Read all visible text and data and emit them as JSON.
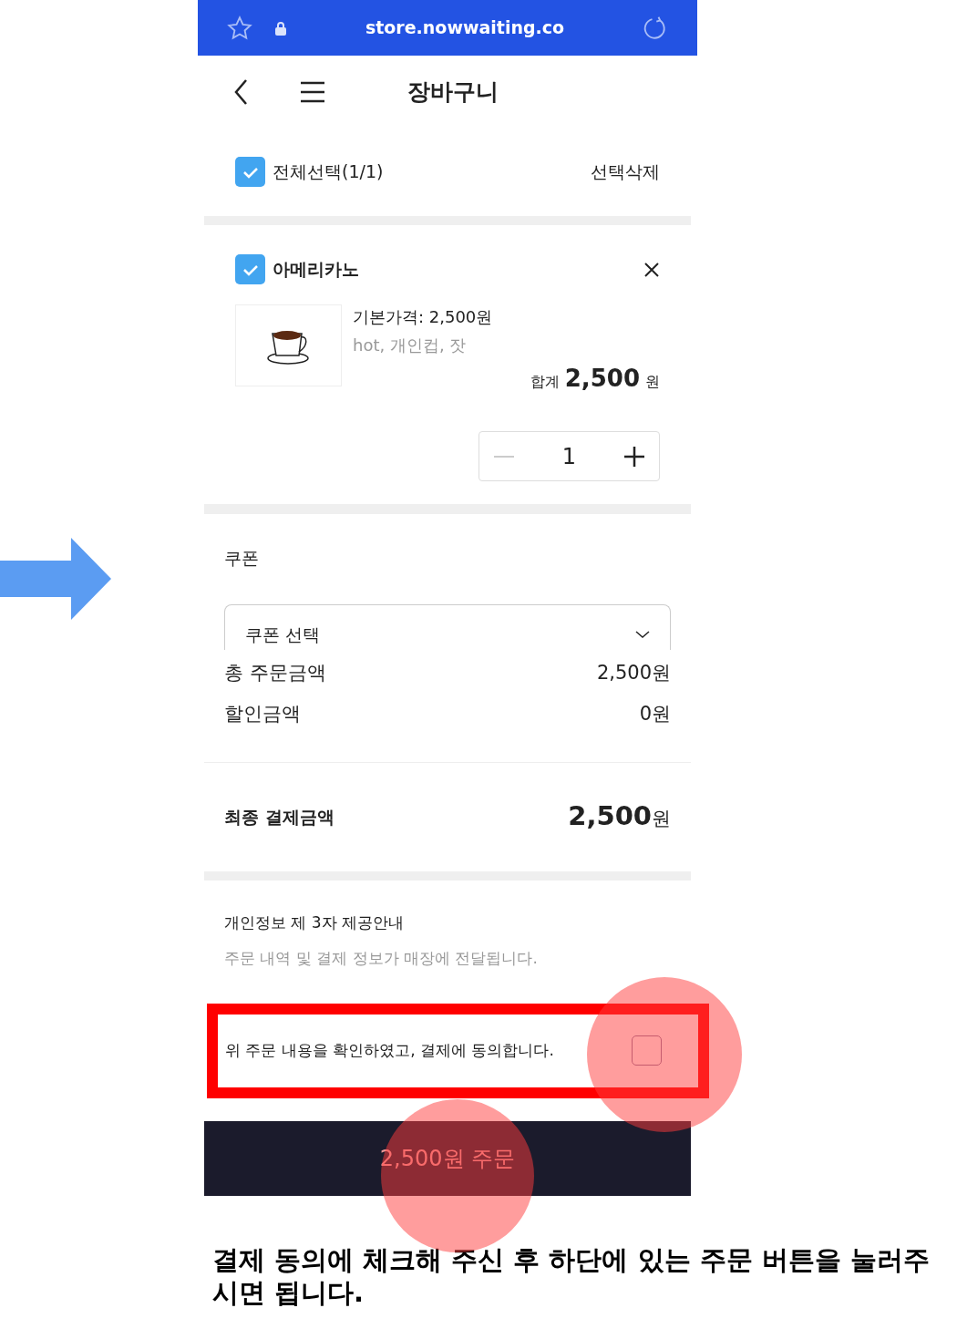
{
  "browser_bar": {
    "url": "store.nowwaiting.co"
  },
  "header": {
    "title": "장바구니"
  },
  "select_all": {
    "label": "전체선택(1/1)",
    "checked": true,
    "delete_label": "선택삭제"
  },
  "cart_items": [
    {
      "name": "아메리카노",
      "checked": true,
      "base_price": "기본가격: 2,500원",
      "options": "hot, 개인컵, 잣",
      "total_label": "합계",
      "total": "2,500",
      "total_unit": "원",
      "quantity": "1"
    }
  ],
  "coupon": {
    "heading": "쿠폰",
    "value": "쿠폰 선택"
  },
  "summary": [
    {
      "label": "총 주문금액",
      "value": "2,500원"
    },
    {
      "label": "할인금액",
      "value": "0원"
    }
  ],
  "final": {
    "label": "최종 결제금액",
    "amount": "2,500",
    "unit": "원"
  },
  "privacy": {
    "title": "개인정보 제 3자 제공안내",
    "text": "주문 내역 및 결제 정보가 매장에 전달됩니다."
  },
  "agreement": {
    "label": "위 주문 내용을 확인하였고, 결제에 동의합니다.",
    "checked": false
  },
  "order_button": "2,500원 주문",
  "caption": "결제 동의에 체크해 주신 후 하단에 있는 주문 버튼을 눌러주시면 됩니다."
}
